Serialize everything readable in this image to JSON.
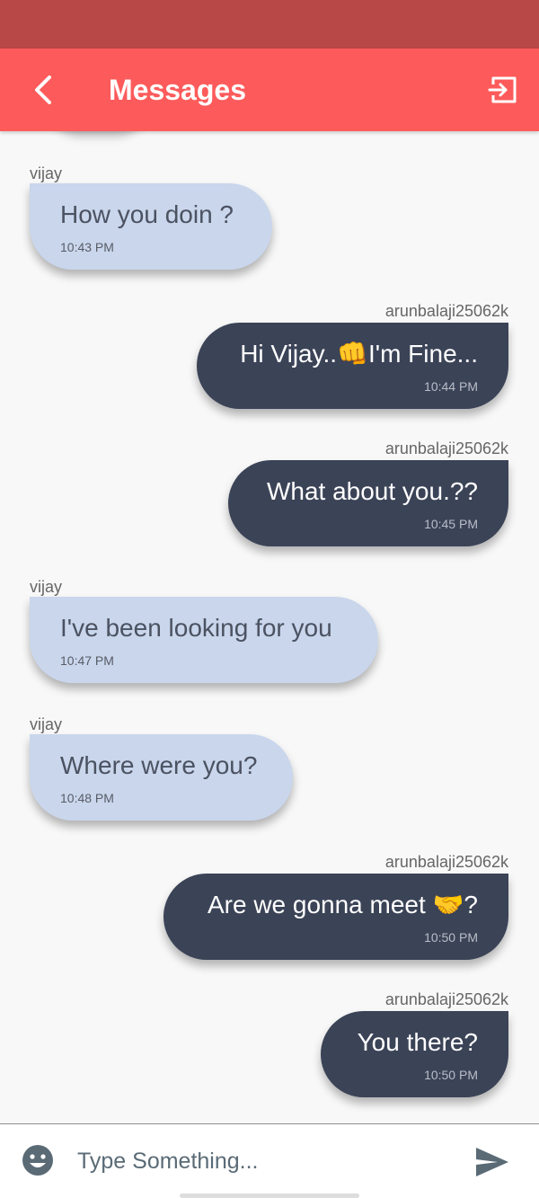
{
  "header": {
    "title": "Messages",
    "back_icon": "chevron-left-icon",
    "logout_icon": "exit-icon"
  },
  "colors": {
    "status_bar": "#b84748",
    "app_bar": "#fd5b5b",
    "incoming_bubble": "#c9d6ec",
    "outgoing_bubble": "#3b4357",
    "background": "#f8f8f8"
  },
  "messages": [
    {
      "sender": "vijay",
      "text": "How you doin ?",
      "time": "10:43 PM",
      "direction": "incoming"
    },
    {
      "sender": "arunbalaji25062k",
      "text": "Hi Vijay..👊I'm Fine...",
      "time": "10:44 PM",
      "direction": "outgoing"
    },
    {
      "sender": "arunbalaji25062k",
      "text": "What about you.??",
      "time": "10:45 PM",
      "direction": "outgoing"
    },
    {
      "sender": "vijay",
      "text": "I've been looking for you",
      "time": "10:47 PM",
      "direction": "incoming"
    },
    {
      "sender": "vijay",
      "text": "Where were you?",
      "time": "10:48 PM",
      "direction": "incoming"
    },
    {
      "sender": "arunbalaji25062k",
      "text": "Are we gonna meet 🤝?",
      "time": "10:50 PM",
      "direction": "outgoing"
    },
    {
      "sender": "arunbalaji25062k",
      "text": "You there?",
      "time": "10:50 PM",
      "direction": "outgoing"
    }
  ],
  "composer": {
    "placeholder": "Type Something...",
    "emoji_icon": "smiley-icon",
    "send_icon": "send-icon"
  }
}
